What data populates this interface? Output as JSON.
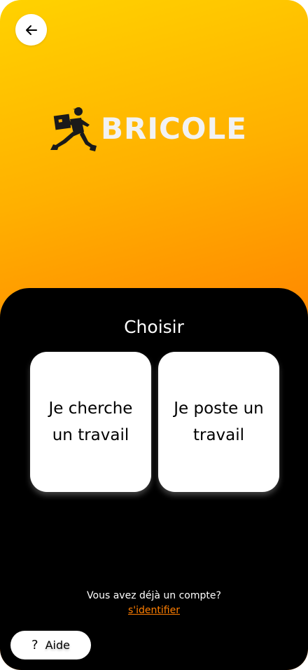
{
  "header": {
    "back_icon": "arrow-left-icon"
  },
  "logo": {
    "text": "BRICOLE",
    "figure_icon": "running-delivery-person-icon"
  },
  "panel": {
    "title": "Choisir",
    "options": [
      {
        "label": "Je cherche un travail"
      },
      {
        "label": "Je poste un travail"
      }
    ]
  },
  "account": {
    "prompt": "Vous avez déjà un compte?",
    "signin_label": "s'identifier"
  },
  "help": {
    "icon": "question-mark-icon",
    "glyph": "?",
    "label": "Aide"
  },
  "colors": {
    "gradient_top": "#FFD200",
    "gradient_bottom": "#FF7E00",
    "panel": "#000000",
    "accent_link": "#FF7E00"
  }
}
